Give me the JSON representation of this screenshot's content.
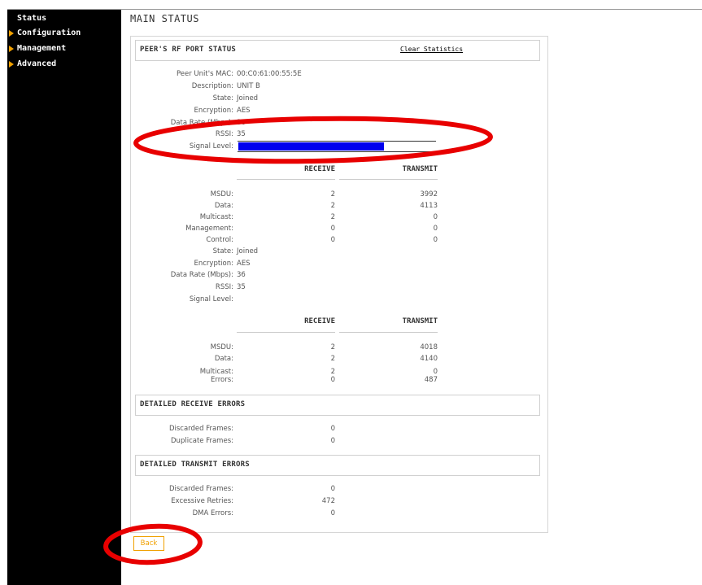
{
  "sidebar": {
    "items": [
      {
        "label": "Status",
        "arrow": false
      },
      {
        "label": "Configuration",
        "arrow": true
      },
      {
        "label": "Management",
        "arrow": true
      },
      {
        "label": "Advanced",
        "arrow": true
      }
    ]
  },
  "page_title": "MAIN STATUS",
  "rf_section": {
    "title": "PEER'S RF PORT STATUS",
    "clear_link": "Clear Statistics"
  },
  "peer": {
    "mac_label": "Peer Unit's MAC:",
    "mac": "00:C0:61:00:55:5E",
    "desc_label": "Description:",
    "desc": "UNIT B",
    "state_label": "State:",
    "state": "Joined",
    "enc_label": "Encryption:",
    "enc": "AES",
    "rate_label": "Data Rate (Mbps):",
    "rate": "36",
    "rssi_label": "RSSI:",
    "rssi": "35",
    "signal_label": "Signal Level:",
    "signal_fraction": 0.74
  },
  "stats1": {
    "receive_header": "RECEIVE",
    "transmit_header": "TRANSMIT",
    "rows": [
      {
        "label": "MSDU:",
        "receive": "2",
        "transmit": "3992"
      },
      {
        "label": "Data:",
        "receive": "2",
        "transmit": "4113"
      },
      {
        "label": "Multicast:",
        "receive": "2",
        "transmit": "0"
      },
      {
        "label": "Management:",
        "receive": "0",
        "transmit": "0"
      },
      {
        "label": "Control:",
        "receive": "0",
        "transmit": "0"
      }
    ]
  },
  "peer2": {
    "state_label": "State:",
    "state": "Joined",
    "enc_label": "Encryption:",
    "enc": "AES",
    "rate_label": "Data Rate (Mbps):",
    "rate": "36",
    "rssi_label": "RSSI:",
    "rssi": "35",
    "signal_label": "Signal Level:"
  },
  "stats2": {
    "receive_header": "RECEIVE",
    "transmit_header": "TRANSMIT",
    "rows": [
      {
        "label": "MSDU:",
        "receive": "2",
        "transmit": "4018"
      },
      {
        "label": "Data:",
        "receive": "2",
        "transmit": "4140"
      },
      {
        "label": "Multicast:",
        "receive": "2",
        "transmit": "0"
      },
      {
        "label": "Errors:",
        "receive": "0",
        "transmit": "487"
      }
    ]
  },
  "rx_errors": {
    "title": "DETAILED RECEIVE ERRORS",
    "rows": [
      {
        "label": "Discarded Frames:",
        "value": "0"
      },
      {
        "label": "Duplicate Frames:",
        "value": "0"
      }
    ]
  },
  "tx_errors": {
    "title": "DETAILED TRANSMIT ERRORS",
    "rows": [
      {
        "label": "Discarded Frames:",
        "value": "0"
      },
      {
        "label": "Excessive Retries:",
        "value": "472"
      },
      {
        "label": "DMA Errors:",
        "value": "0"
      }
    ]
  },
  "back_label": "Back",
  "colors": {
    "signal_bar": "#0000ee",
    "accent_orange": "#f0a000",
    "annotation_red": "#e80000"
  }
}
